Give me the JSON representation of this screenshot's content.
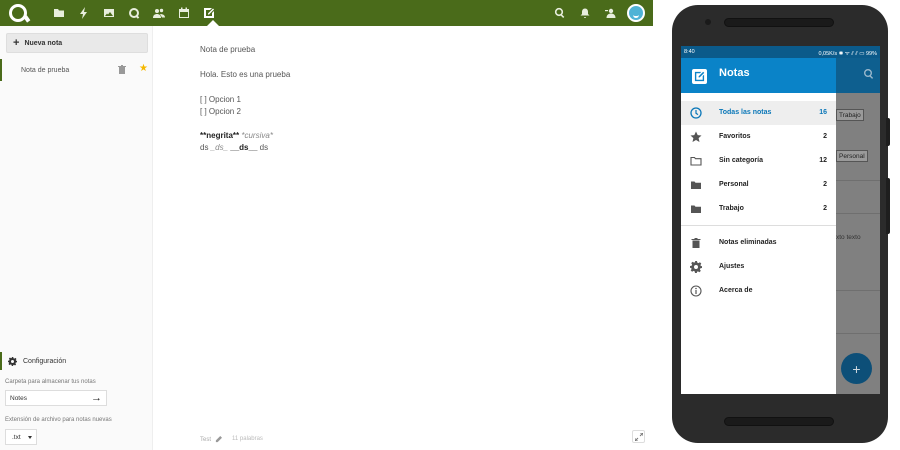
{
  "desktop": {
    "sidebar": {
      "new_note_label": "Nueva nota",
      "note_items": [
        {
          "title": "Nota de prueba",
          "favorite": true
        }
      ],
      "settings": {
        "title": "Configuración",
        "folder_label": "Carpeta para almacenar tus notas",
        "folder_value": "Notes",
        "extension_label": "Extensión de archivo para notas nuevas",
        "extension_value": ".txt"
      }
    },
    "editor": {
      "lines": {
        "title": "Nota de prueba",
        "body": "Hola. Esto es una prueba",
        "option1": "[ ] Opcion 1",
        "option2": "[ ] Opcion 2",
        "bold": "**negrita**",
        "italic": "*cursiva*",
        "mixed_start": "ds ",
        "mixed_italic": "_ds_",
        "mixed_bold": "__ds__",
        "mixed_end": " ds"
      },
      "footer": {
        "category": "Test",
        "word_count": "11 palabras"
      }
    },
    "colors": {
      "header": "#4a6b1a",
      "favorite": "#f5b800"
    }
  },
  "phone": {
    "status": {
      "time": "8:40",
      "right": "0,05K/s ✱ ᯤ ⫽ ⫽ ▭ 99%"
    },
    "drawer": {
      "title": "Notas",
      "items": [
        {
          "label": "Todas las notas",
          "count": "16",
          "icon": "clock-icon",
          "selected": true
        },
        {
          "label": "Favoritos",
          "count": "2",
          "icon": "star-icon"
        },
        {
          "label": "Sin categoría",
          "count": "12",
          "icon": "folder-outline-icon"
        },
        {
          "label": "Personal",
          "count": "2",
          "icon": "folder-icon"
        },
        {
          "label": "Trabajo",
          "count": "2",
          "icon": "folder-icon"
        }
      ],
      "secondary": [
        {
          "label": "Notas eliminadas",
          "icon": "trash-icon"
        },
        {
          "label": "Ajustes",
          "icon": "gear-icon"
        },
        {
          "label": "Acerca de",
          "icon": "info-icon"
        }
      ]
    },
    "background": {
      "tag1": "Trabajo",
      "tag2": "Personal",
      "text": "xto texto"
    },
    "colors": {
      "drawer_header": "#0a83c8",
      "statusbar": "#0b5a8a",
      "selected_text": "#0a77b8"
    }
  }
}
